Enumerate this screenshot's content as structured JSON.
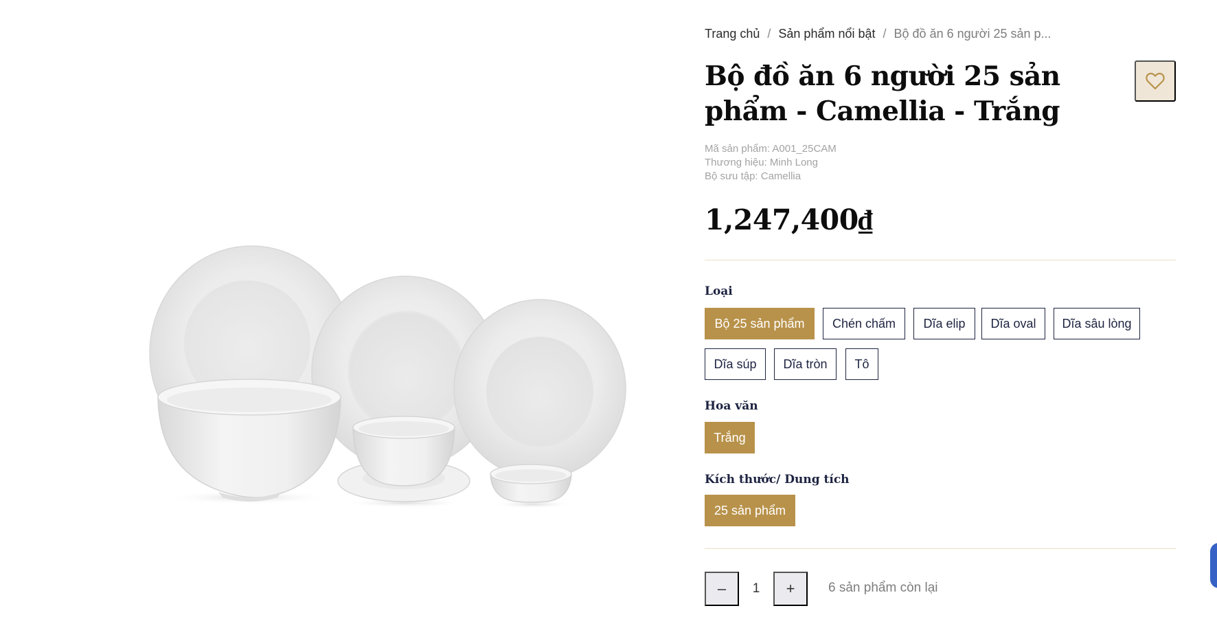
{
  "product_image": {
    "alt": "Bộ đồ ăn 6 người 25 sản phẩm - Camellia - Trắng"
  },
  "breadcrumb": {
    "items": [
      "Trang chủ",
      "Sản phẩm nổi bật"
    ],
    "current": "Bộ đồ ăn 6 người 25 sản p...",
    "separator": "/"
  },
  "product": {
    "title": "Bộ đồ ăn 6 người 25 sản phẩm - Camellia - Trắng",
    "sku": "Mã sản phẩm: A001_25CAM",
    "brand": "Thương hiệu: Minh Long",
    "collection": "Bộ sưu tập: Camellia",
    "price": "1,247,400₫"
  },
  "wishlist": {
    "icon": "heart-icon"
  },
  "options": {
    "type": {
      "label": "Loại",
      "values": [
        "Bộ 25 sản phẩm",
        "Chén chấm",
        "Dĩa elip",
        "Dĩa oval",
        "Dĩa sâu lòng",
        "Dĩa súp",
        "Dĩa tròn",
        "Tô"
      ],
      "selected": "Bộ 25 sản phẩm"
    },
    "pattern": {
      "label": "Hoa văn",
      "values": [
        "Trắng"
      ],
      "selected": "Trắng"
    },
    "size": {
      "label": "Kích thước/ Dung tích",
      "values": [
        "25 sản phẩm"
      ],
      "selected": "25 sản phẩm"
    }
  },
  "quantity": {
    "decrement": "–",
    "value": "1",
    "increment": "+",
    "stock_text": "6 sản phẩm còn lại"
  },
  "colors": {
    "accent": "#b8924a",
    "chip_border": "#1d2340",
    "wishlist_bg": "#efe6d7",
    "divider": "#e9dfc9"
  }
}
